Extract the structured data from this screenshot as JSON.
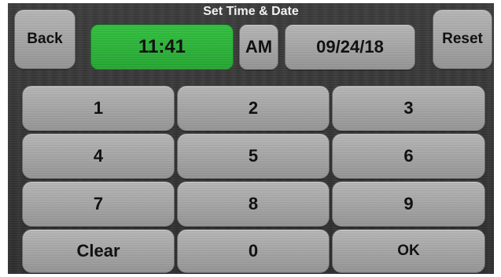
{
  "header": {
    "title": "Set Time & Date",
    "back_label": "Back",
    "reset_label": "Reset"
  },
  "display": {
    "time": "11:41",
    "ampm": "AM",
    "date": "09/24/18"
  },
  "keypad": {
    "rows": [
      [
        "1",
        "2",
        "3"
      ],
      [
        "4",
        "5",
        "6"
      ],
      [
        "7",
        "8",
        "9"
      ],
      [
        "Clear",
        "0",
        "OK"
      ]
    ]
  },
  "colors": {
    "time_field": "#2fbf3c",
    "button": "#a8a8a8",
    "background": "#333333"
  }
}
